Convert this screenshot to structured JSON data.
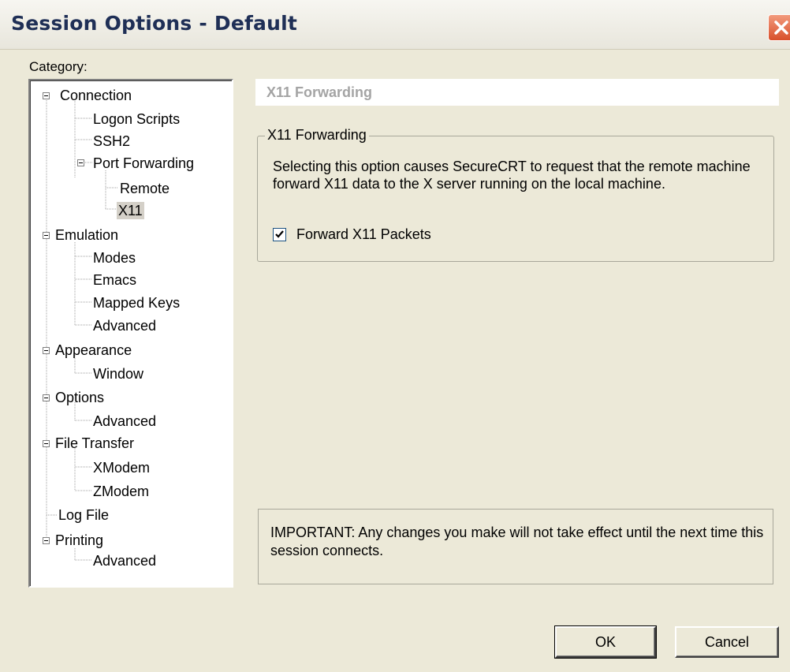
{
  "window": {
    "title": "Session Options - Default"
  },
  "category": {
    "label": "Category:"
  },
  "tree": {
    "nodes": [
      {
        "label": "Connection",
        "expandable": true
      },
      {
        "label": "Logon Scripts"
      },
      {
        "label": "SSH2"
      },
      {
        "label": "Port Forwarding",
        "expandable": true
      },
      {
        "label": "Remote"
      },
      {
        "label": "X11",
        "selected": true
      },
      {
        "label": "Emulation",
        "expandable": true
      },
      {
        "label": "Modes"
      },
      {
        "label": "Emacs"
      },
      {
        "label": "Mapped Keys"
      },
      {
        "label": "Advanced"
      },
      {
        "label": "Appearance",
        "expandable": true
      },
      {
        "label": "Window"
      },
      {
        "label": "Options",
        "expandable": true
      },
      {
        "label": "Advanced"
      },
      {
        "label": "File Transfer",
        "expandable": true
      },
      {
        "label": "XModem"
      },
      {
        "label": "ZModem"
      },
      {
        "label": "Log File"
      },
      {
        "label": "Printing",
        "expandable": true
      },
      {
        "label": "Advanced"
      }
    ]
  },
  "page": {
    "header": "X11 Forwarding",
    "group": {
      "legend": "X11 Forwarding",
      "description": "Selecting this option causes SecureCRT to request that the remote machine forward X11 data to the X server running on the local machine.",
      "checkbox_label": "Forward X11 Packets",
      "checkbox_checked": true
    },
    "important": "IMPORTANT: Any changes you make will not take effect until the next time this session connects."
  },
  "buttons": {
    "ok": "OK",
    "cancel": "Cancel"
  }
}
